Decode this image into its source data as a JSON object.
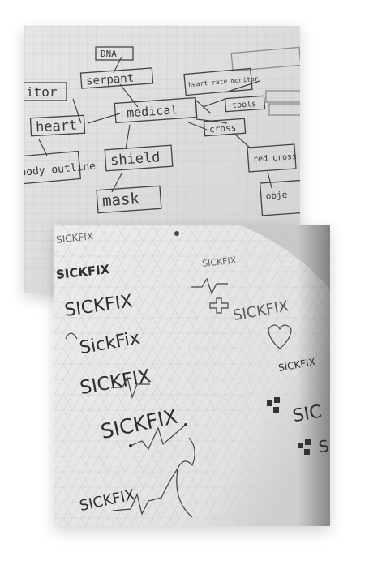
{
  "photos": {
    "top": {
      "nodes": [
        "DNA",
        "serpant",
        "itor",
        "heart",
        "medical",
        "heart rate monitor",
        "tools",
        "cross",
        "shield",
        "body outline",
        "red cross",
        "mask",
        "obje"
      ]
    },
    "bottom": {
      "logos": [
        "SICKFIX",
        "SICKFIX",
        "SICKFIX",
        "SickFix",
        "SICKFIX",
        "SICKFIX",
        "SICKFIX",
        "SICKFIX",
        "SICKFIX",
        "SICKFIX",
        "SIC",
        "S"
      ]
    }
  }
}
